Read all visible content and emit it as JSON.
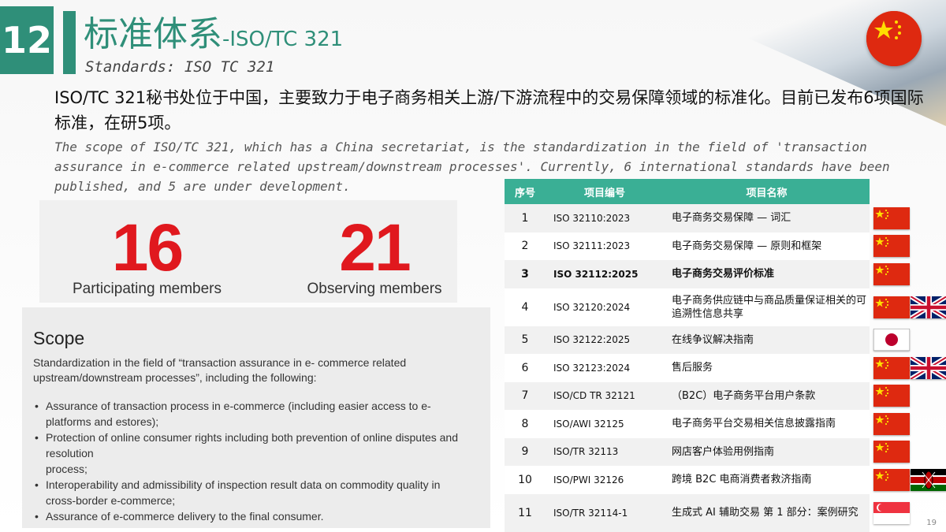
{
  "section_number": "12",
  "title_cn": "标准体系",
  "title_suffix": "-ISO/TC 321",
  "title_en": "Standards: ISO TC 321",
  "intro_cn": "ISO/TC 321秘书处位于中国，主要致力于电子商务相关上游/下游流程中的交易保障领域的标准化。目前已发布6项国际标准，在研5项。",
  "intro_en": "The scope of ISO/TC 321, which has a China secretariat, is the standardization in the field of 'transaction assurance in e-commerce related upstream/downstream processes'. Currently, 6 international standards have been published, and 5 are under development.",
  "stats": [
    {
      "value": "16",
      "label": "Participating members"
    },
    {
      "value": "21",
      "label": "Observing members"
    }
  ],
  "colors": {
    "accent": "#2f8f79",
    "header": "#3aaf95",
    "stat_red": "#e0181e"
  },
  "scope": {
    "heading": "Scope",
    "intro": "Standardization in the field of “transaction assurance in e- commerce related upstream/downstream processes”, including the following:",
    "items": [
      [
        "Assurance of transaction process in e-commerce (including easier access to e-",
        "platforms and estores);"
      ],
      [
        "Protection of online consumer rights including both prevention of online disputes and",
        "resolution",
        "process;"
      ],
      [
        "Interoperability and admissibility of inspection result data on commodity quality in",
        "cross-border e-commerce;"
      ],
      [
        "Assurance of e-commerce delivery to the final consumer."
      ]
    ]
  },
  "table": {
    "headers": [
      "序号",
      "项目编号",
      "项目名称"
    ],
    "rows": [
      {
        "seq": "1",
        "code": "ISO 32110:2023",
        "name": "电子商务交易保障 — 词汇",
        "flags": [
          "cn"
        ]
      },
      {
        "seq": "2",
        "code": "ISO 32111:2023",
        "name": "电子商务交易保障 — 原则和框架",
        "flags": [
          "cn"
        ]
      },
      {
        "seq": "3",
        "code": "ISO 32112:2025",
        "name": "电子商务交易评价标准",
        "flags": [
          "cn"
        ],
        "bold": true
      },
      {
        "seq": "4",
        "code": "ISO 32120:2024",
        "name": "电子商务供应链中与商品质量保证相关的可追溯性信息共享",
        "flags": [
          "cn",
          "uk"
        ],
        "tall": true
      },
      {
        "seq": "5",
        "code": "ISO 32122:2025",
        "name": "在线争议解决指南",
        "flags": [
          "jp"
        ]
      },
      {
        "seq": "6",
        "code": "ISO 32123:2024",
        "name": "售后服务",
        "flags": [
          "cn",
          "uk"
        ]
      },
      {
        "seq": "7",
        "code": "ISO/CD TR 32121",
        "name": "（B2C）电子商务平台用户条款",
        "flags": [
          "cn"
        ]
      },
      {
        "seq": "8",
        "code": "ISO/AWI 32125",
        "name": "电子商务平台交易相关信息披露指南",
        "flags": [
          "cn"
        ]
      },
      {
        "seq": "9",
        "code": "ISO/TR 32113",
        "name": "网店客户体验用例指南",
        "flags": [
          "cn"
        ]
      },
      {
        "seq": "10",
        "code": "ISO/PWI 32126",
        "name": "跨境 B2C 电商消费者救济指南",
        "flags": [
          "cn",
          "ke"
        ]
      },
      {
        "seq": "11",
        "code": "ISO/TR 32114-1",
        "name": "生成式 AI 辅助交易 第 1 部分：案例研究",
        "flags": [
          "sg"
        ],
        "tall": true
      }
    ]
  },
  "page_number": "19"
}
